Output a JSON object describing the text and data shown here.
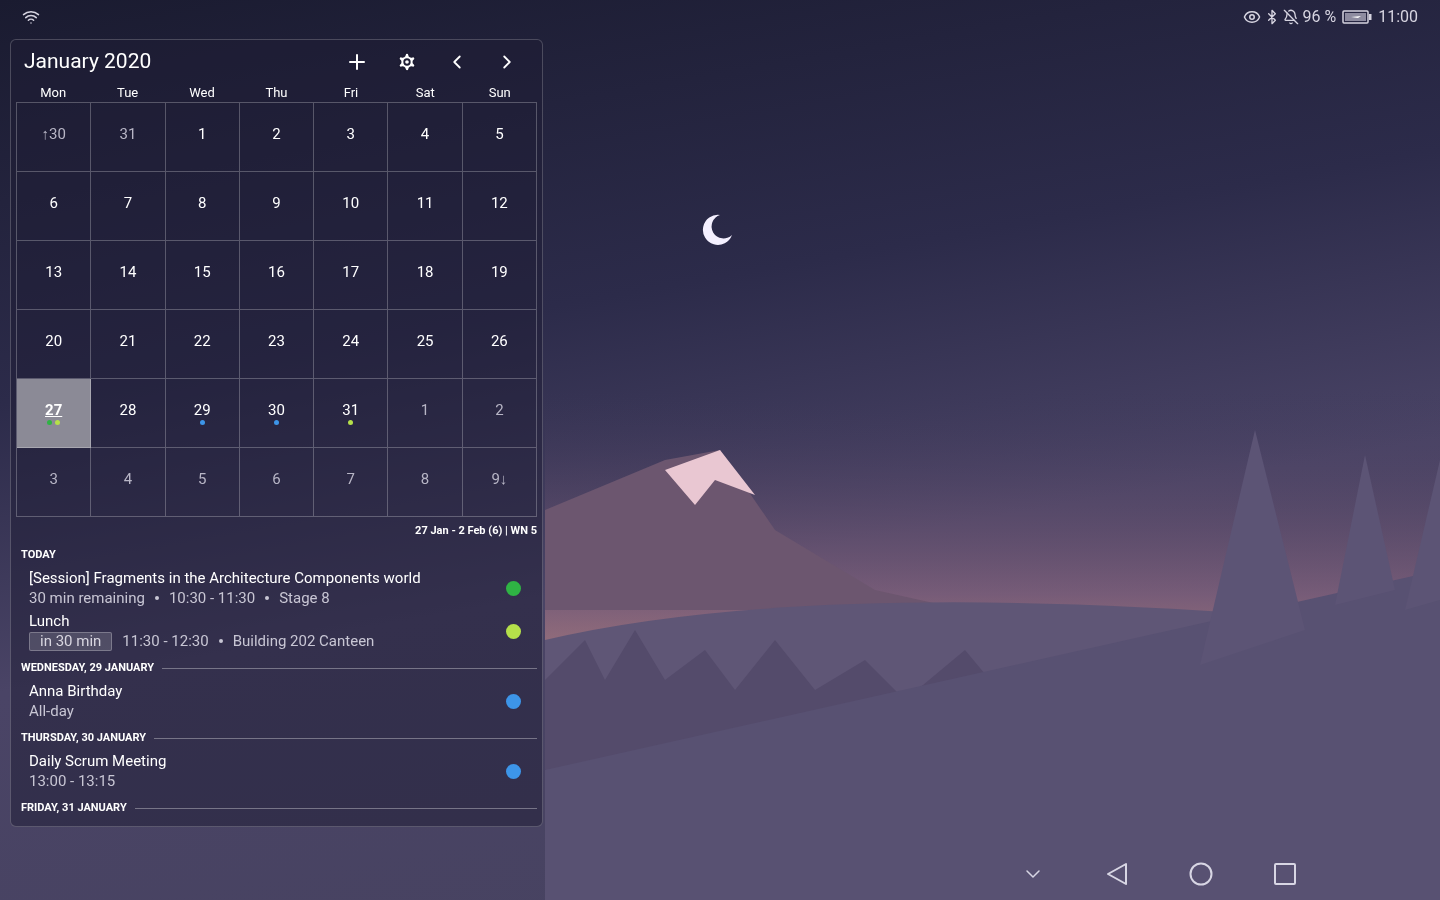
{
  "status_bar": {
    "battery_percent": "96 %",
    "time": "11:00"
  },
  "calendar": {
    "title": "January 2020",
    "weekdays": [
      "Mon",
      "Tue",
      "Wed",
      "Thu",
      "Fri",
      "Sat",
      "Sun"
    ],
    "weeks": [
      [
        {
          "label": "↑30",
          "muted": true,
          "selected": false
        },
        {
          "label": "31",
          "muted": true,
          "selected": false
        },
        {
          "label": "1",
          "muted": false,
          "selected": false
        },
        {
          "label": "2",
          "muted": false,
          "selected": false
        },
        {
          "label": "3",
          "muted": false,
          "selected": false
        },
        {
          "label": "4",
          "muted": false,
          "selected": false
        },
        {
          "label": "5",
          "muted": false,
          "selected": false
        }
      ],
      [
        {
          "label": "6",
          "muted": false,
          "selected": false
        },
        {
          "label": "7",
          "muted": false,
          "selected": false
        },
        {
          "label": "8",
          "muted": false,
          "selected": false
        },
        {
          "label": "9",
          "muted": false,
          "selected": false
        },
        {
          "label": "10",
          "muted": false,
          "selected": false
        },
        {
          "label": "11",
          "muted": false,
          "selected": false
        },
        {
          "label": "12",
          "muted": false,
          "selected": false
        }
      ],
      [
        {
          "label": "13",
          "muted": false,
          "selected": false
        },
        {
          "label": "14",
          "muted": false,
          "selected": false
        },
        {
          "label": "15",
          "muted": false,
          "selected": false
        },
        {
          "label": "16",
          "muted": false,
          "selected": false
        },
        {
          "label": "17",
          "muted": false,
          "selected": false
        },
        {
          "label": "18",
          "muted": false,
          "selected": false
        },
        {
          "label": "19",
          "muted": false,
          "selected": false
        }
      ],
      [
        {
          "label": "20",
          "muted": false,
          "selected": false
        },
        {
          "label": "21",
          "muted": false,
          "selected": false
        },
        {
          "label": "22",
          "muted": false,
          "selected": false
        },
        {
          "label": "23",
          "muted": false,
          "selected": false
        },
        {
          "label": "24",
          "muted": false,
          "selected": false
        },
        {
          "label": "25",
          "muted": false,
          "selected": false
        },
        {
          "label": "26",
          "muted": false,
          "selected": false
        }
      ],
      [
        {
          "label": "27",
          "muted": false,
          "selected": true,
          "dots": [
            {
              "color": "#2fb344"
            },
            {
              "color": "#b5e04a"
            }
          ]
        },
        {
          "label": "28",
          "muted": false,
          "selected": false
        },
        {
          "label": "29",
          "muted": false,
          "selected": false,
          "dots": [
            {
              "color": "#3d95e8"
            }
          ]
        },
        {
          "label": "30",
          "muted": false,
          "selected": false,
          "dots": [
            {
              "color": "#3d95e8"
            }
          ]
        },
        {
          "label": "31",
          "muted": false,
          "selected": false,
          "dots": [
            {
              "color": "#b5e04a"
            }
          ]
        },
        {
          "label": "1",
          "muted": true,
          "selected": false
        },
        {
          "label": "2",
          "muted": true,
          "selected": false
        }
      ],
      [
        {
          "label": "3",
          "muted": true,
          "selected": false
        },
        {
          "label": "4",
          "muted": true,
          "selected": false
        },
        {
          "label": "5",
          "muted": true,
          "selected": false
        },
        {
          "label": "6",
          "muted": true,
          "selected": false
        },
        {
          "label": "7",
          "muted": true,
          "selected": false
        },
        {
          "label": "8",
          "muted": true,
          "selected": false
        },
        {
          "label": "9↓",
          "muted": true,
          "selected": false
        }
      ]
    ],
    "week_range": "27 Jan - 2 Feb (6) | WN 5"
  },
  "agenda": [
    {
      "heading": "TODAY",
      "events": [
        {
          "title": "[Session] Fragments in the Architecture Components world",
          "details": [
            "30 min remaining",
            "10:30 - 11:30",
            "Stage 8"
          ],
          "color": "#2fb344"
        },
        {
          "title": "Lunch",
          "badge": "in 30 min",
          "details": [
            "11:30 - 12:30",
            "Building 202 Canteen"
          ],
          "color": "#b5e04a"
        }
      ]
    },
    {
      "heading": "WEDNESDAY, 29 JANUARY",
      "events": [
        {
          "title": "Anna Birthday",
          "details": [
            "All-day"
          ],
          "color": "#3d95e8"
        }
      ]
    },
    {
      "heading": "THURSDAY, 30 JANUARY",
      "events": [
        {
          "title": "Daily Scrum Meeting",
          "details": [
            "13:00 - 13:15"
          ],
          "color": "#3d95e8"
        }
      ]
    },
    {
      "heading": "FRIDAY, 31 JANUARY"
    }
  ]
}
